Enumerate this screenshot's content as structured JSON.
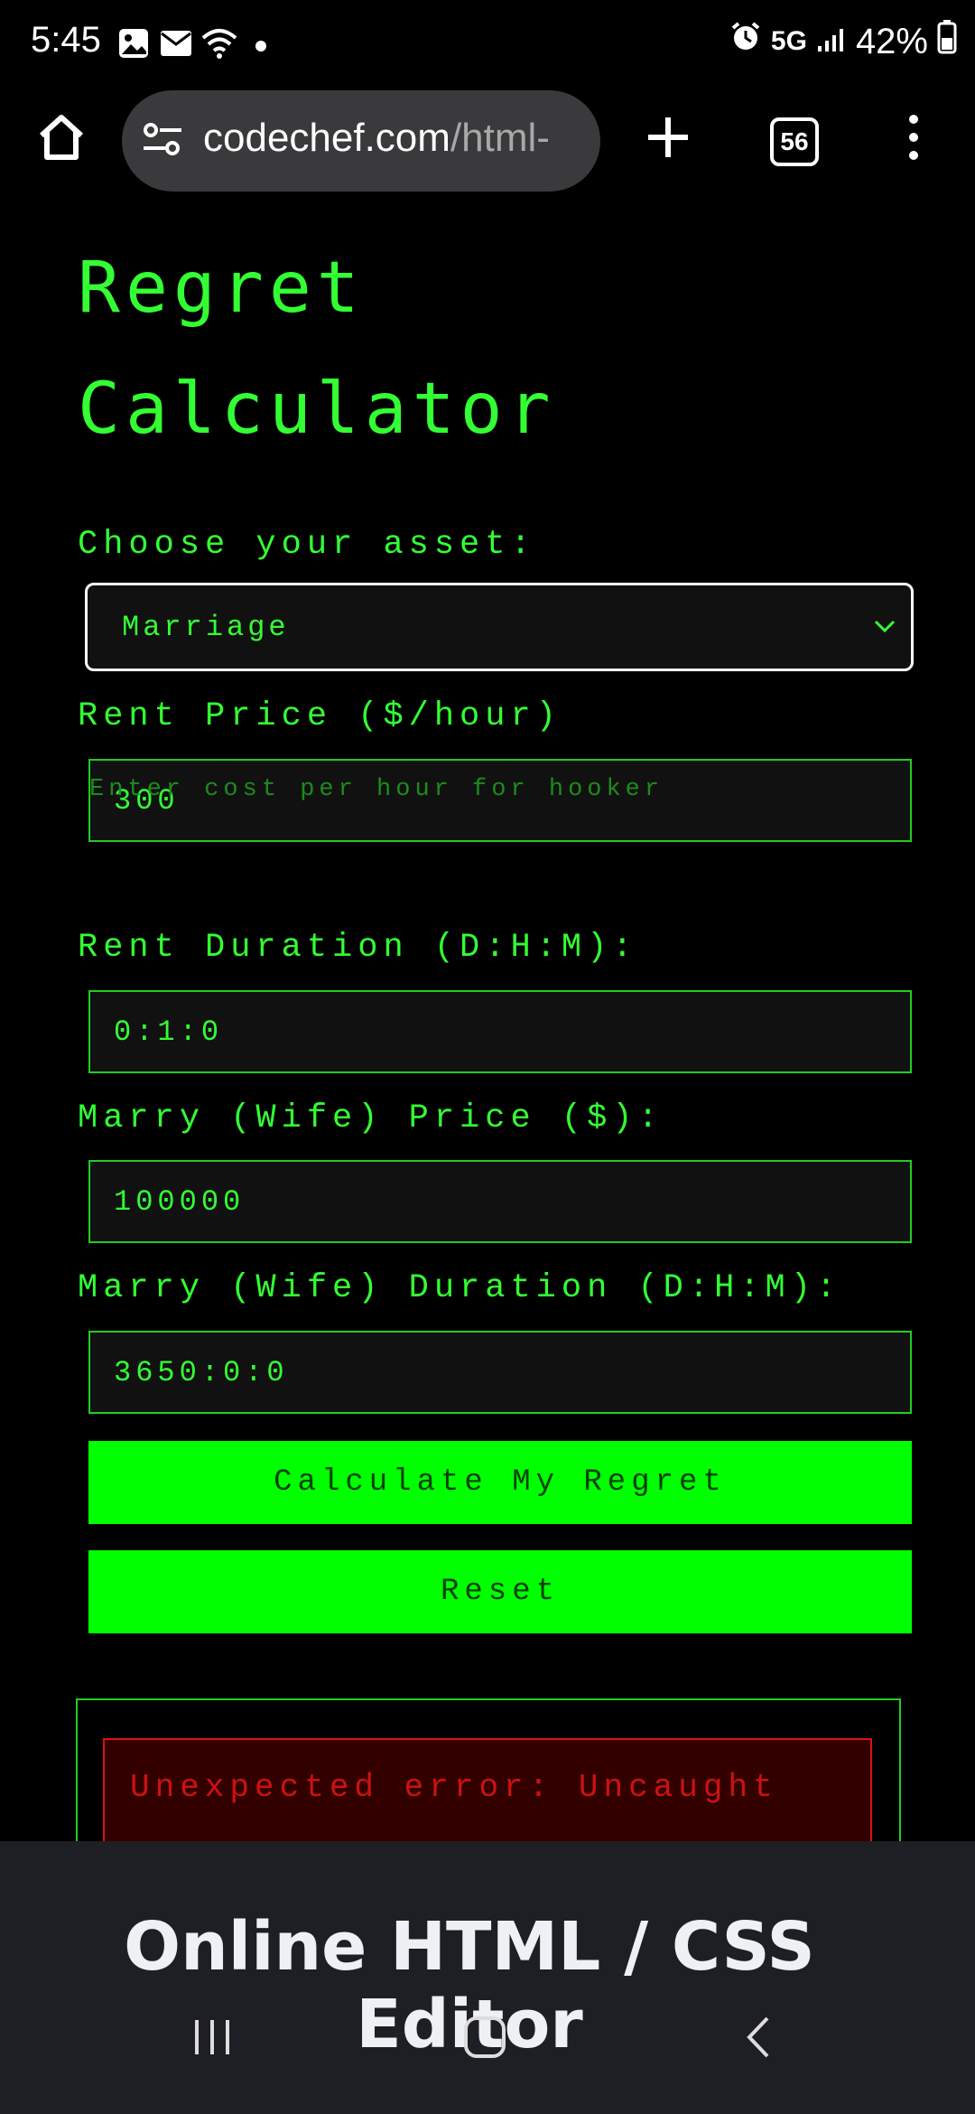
{
  "status_bar": {
    "time": "5:45",
    "network": "5G",
    "battery": "42%"
  },
  "browser": {
    "url_domain": "codechef.com",
    "url_path": "/html-",
    "tab_count": "56"
  },
  "page": {
    "title_line1": "Regret",
    "title_line2": "Calculator",
    "asset_label": "Choose your asset:",
    "asset_value": "Marriage",
    "rent_price_label": "Rent Price ($/hour)",
    "rent_price_value": "300",
    "rent_price_hint": "Enter cost per hour for hooker",
    "rent_duration_label": "Rent Duration (D:H:M):",
    "rent_duration_value": "0:1:0",
    "marry_price_label": "Marry (Wife) Price ($):",
    "marry_price_value": "100000",
    "marry_duration_label": "Marry (Wife) Duration (D:H:M):",
    "marry_duration_value": "3650:0:0",
    "calculate_label": "Calculate My Regret",
    "reset_label": "Reset",
    "error_text": "Unexpected error: Uncaught"
  },
  "banner": {
    "title": "Online HTML / CSS Editor"
  },
  "colors": {
    "accent_green": "#00ff00",
    "text_green": "#33ff33",
    "error_red": "#cc1111",
    "banner_bg": "#1e1f24"
  },
  "icons": {
    "status_left": [
      "image-icon",
      "mail-icon",
      "wifi-icon",
      "dot-icon"
    ],
    "status_right": [
      "alarm-icon",
      "signal-icon",
      "battery-icon"
    ],
    "toolbar": [
      "home-icon",
      "site-settings-icon",
      "plus-icon",
      "tabs-icon",
      "more-vert-icon"
    ],
    "nav": [
      "recents-icon",
      "home-nav-icon",
      "back-icon"
    ]
  }
}
